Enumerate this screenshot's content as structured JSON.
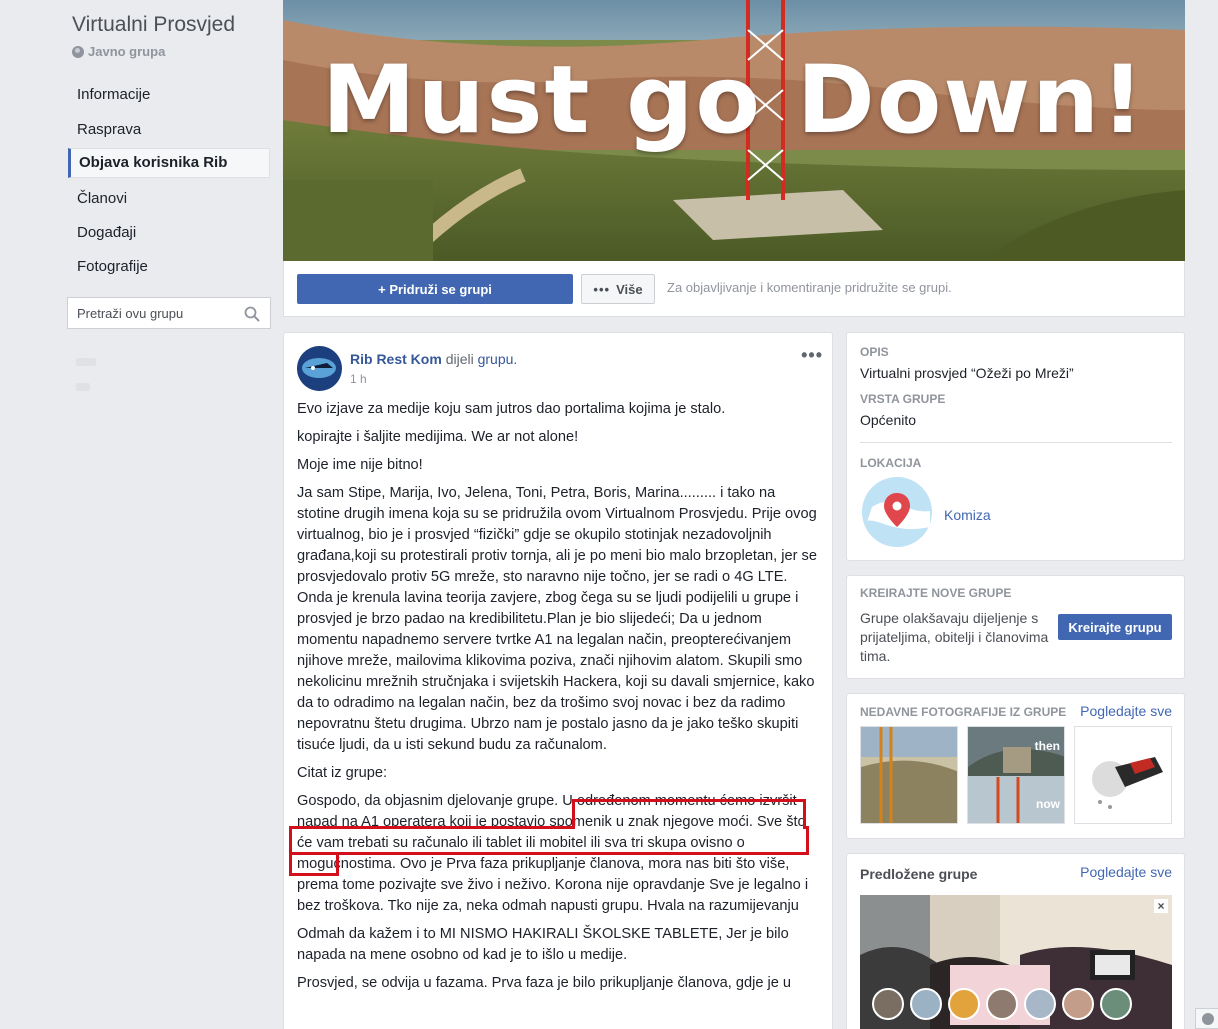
{
  "sidebar": {
    "group_title": "Virtualni Prosvjed",
    "privacy": "Javno grupa",
    "items": [
      {
        "label": "Informacije"
      },
      {
        "label": "Rasprava"
      },
      {
        "label": "Objava korisnika Rib"
      },
      {
        "label": "Članovi"
      },
      {
        "label": "Događaji"
      },
      {
        "label": "Fotografije"
      }
    ],
    "search_placeholder": "Pretraži ovu grupu"
  },
  "cover": {
    "title": "Must go Down!"
  },
  "actionbar": {
    "join_label": "+ Pridruži se grupi",
    "more_label": "Više",
    "hint": "Za objavljivanje i komentiranje pridružite se grupi."
  },
  "post": {
    "author": "Rib Rest Kom",
    "shared_text": "dijeli",
    "shared_link": "grupu.",
    "time": "1 h",
    "paragraphs": [
      "Evo izjave za medije koju sam jutros dao portalima kojima je stalo.",
      "kopirajte i šaljite medijima. We ar not alone!",
      "Moje ime nije bitno!",
      "Ja sam Stipe, Marija, Ivo, Jelena, Toni, Petra, Boris, Marina......... i tako na stotine drugih imena koja su se pridružila ovom Virtualnom Prosvjedu. Prije ovog virtualnog, bio je i prosvjed “fizički” gdje se okupilo stotinjak nezadovoljnih građana,koji su protestirali protiv tornja, ali je po meni bio malo brzopletan, jer se prosvjedovalo protiv 5G mreže, sto naravno nije točno, jer se radi o 4G LTE. Onda je krenula lavina teorija zavjere, zbog čega su se ljudi podijelili u grupe i prosvjed je brzo padao na kredibilitetu.Plan je bio slijedeći; Da u jednom momentu napadnemo servere tvrtke A1 na legalan način, preopterećivanjem njihove mreže, mailovima klikovima poziva, znači njihovim alatom. Skupili smo nekolicinu mrežnih stručnjaka i svijetskih Hackera, koji su davali smjernice, kako da to odradimo na legalan način, bez da trošimo svoj novac i bez da radimo nepovratnu štetu drugima. Ubrzo nam je postalo jasno da je jako teško skupiti tisuće ljudi, da u isti sekund budu za računalom.",
      "Citat iz grupe:",
      "Gospodo, da objasnim djelovanje grupe. U određenom momentu ćemo izvršit napad na A1 operatera koji je postavio spomenik u znak njegove moći. Sve što će vam trebati su računalo ili tablet ili mobitel ili sva tri skupa ovisno o mogućnostima. Ovo je Prva faza prikupljanje članova, mora nas biti što više, prema tome pozivajte sve živo i neživo. Korona nije opravdanje Sve je legalno i bez troškova. Tko nije za, neka odmah napusti grupu. Hvala na razumijevanju",
      "Odmah da kažem i to MI NISMO HAKIRALI ŠKOLSKE TABLETE, Jer je bilo napada na mene osobno od kad je to išlo u medije.",
      "Prosvjed, se odvija u fazama. Prva faza je bilo prikupljanje članova, gdje je u"
    ]
  },
  "about": {
    "opis_label": "OPIS",
    "opis": "Virtualni prosvjed “Ožeži po Mreži”",
    "type_label": "VRSTA GRUPE",
    "type": "Općenito",
    "location_label": "LOKACIJA",
    "location": "Komiza"
  },
  "create": {
    "header": "KREIRAJTE NOVE GRUPE",
    "text": "Grupe olakšavaju dijeljenje s prijateljima, obitelji i članovima tima.",
    "button": "Kreirajte grupu"
  },
  "photos": {
    "header": "NEDAVNE FOTOGRAFIJE IZ GRUPE",
    "see_all": "Pogledajte sve",
    "then_label": "then",
    "now_label": "now"
  },
  "suggested": {
    "header": "Predložene grupe",
    "see_all": "Pogledajte sve"
  },
  "colors": {
    "brand": "#4267b2",
    "link": "#365899",
    "highlight": "#d20f1a"
  }
}
